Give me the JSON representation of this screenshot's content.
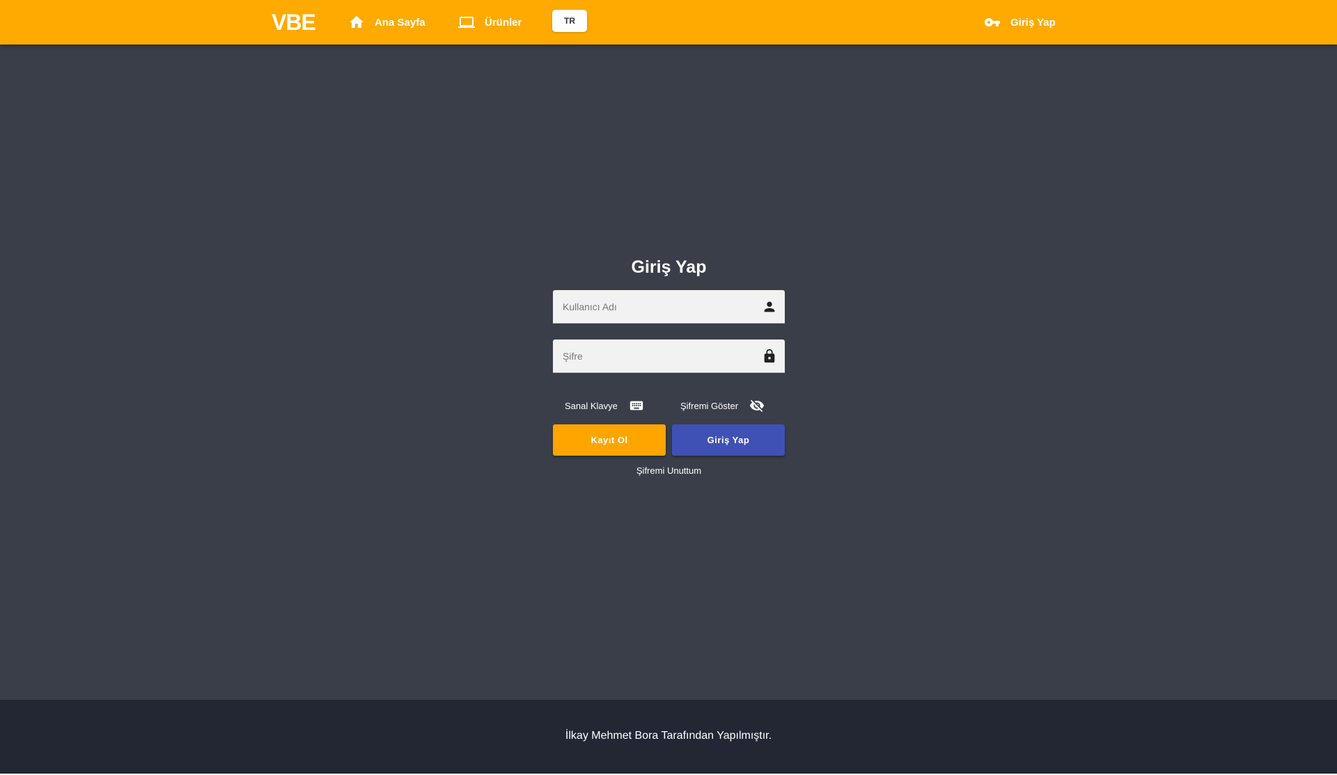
{
  "header": {
    "brand": "VBE",
    "nav": {
      "home_label": "Ana Sayfa",
      "products_label": "Ürünler",
      "language": "TR",
      "login_label": "Giriş Yap"
    },
    "icons": {
      "home": "home-icon",
      "products": "laptop-icon",
      "login": "key-icon"
    },
    "color": "#ffaa00"
  },
  "login_form": {
    "title": "Giriş Yap",
    "username_placeholder": "Kullanıcı Adı",
    "password_placeholder": "Şifre",
    "virtual_keyboard_label": "Sanal Klavye",
    "show_password_label": "Şifremi Göster",
    "register_button": "Kayıt Ol",
    "login_button": "Giriş Yap",
    "forgot_password": "Şifremi Unuttum",
    "icons": {
      "username": "person-icon",
      "password": "lock-icon",
      "keyboard": "keyboard-icon",
      "show_password": "eye-off-icon"
    },
    "colors": {
      "register": "#ffa500",
      "login": "#3f51b5"
    }
  },
  "footer": {
    "text": "İlkay Mehmet Bora Tarafından Yapılmıştır."
  }
}
